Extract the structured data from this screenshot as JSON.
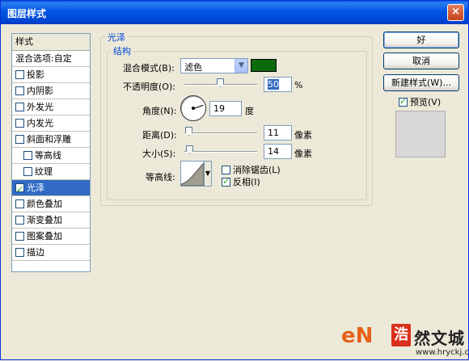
{
  "window": {
    "title": "图层样式",
    "close_glyph": "×"
  },
  "style_list": {
    "header": "样式",
    "items": [
      {
        "label": "混合选项:自定",
        "checkbox": false,
        "checked": false,
        "indent": false,
        "selected": false
      },
      {
        "label": "投影",
        "checkbox": true,
        "checked": false,
        "indent": false,
        "selected": false
      },
      {
        "label": "内阴影",
        "checkbox": true,
        "checked": false,
        "indent": false,
        "selected": false
      },
      {
        "label": "外发光",
        "checkbox": true,
        "checked": false,
        "indent": false,
        "selected": false
      },
      {
        "label": "内发光",
        "checkbox": true,
        "checked": false,
        "indent": false,
        "selected": false
      },
      {
        "label": "斜面和浮雕",
        "checkbox": true,
        "checked": false,
        "indent": false,
        "selected": false
      },
      {
        "label": "等高线",
        "checkbox": true,
        "checked": false,
        "indent": true,
        "selected": false
      },
      {
        "label": "纹理",
        "checkbox": true,
        "checked": false,
        "indent": true,
        "selected": false
      },
      {
        "label": "光泽",
        "checkbox": true,
        "checked": true,
        "indent": false,
        "selected": true
      },
      {
        "label": "颜色叠加",
        "checkbox": true,
        "checked": false,
        "indent": false,
        "selected": false
      },
      {
        "label": "渐变叠加",
        "checkbox": true,
        "checked": false,
        "indent": false,
        "selected": false
      },
      {
        "label": "图案叠加",
        "checkbox": true,
        "checked": false,
        "indent": false,
        "selected": false
      },
      {
        "label": "描边",
        "checkbox": true,
        "checked": false,
        "indent": false,
        "selected": false
      }
    ]
  },
  "satin": {
    "group_title": "光泽",
    "structure_title": "结构",
    "blend_mode_label": "混合模式(B):",
    "blend_mode_value": "滤色",
    "color": "#0b6a0b",
    "opacity_label": "不透明度(O):",
    "opacity_value": "50",
    "opacity_unit": "%",
    "opacity_fraction": 0.5,
    "angle_label": "角度(N):",
    "angle_value": "19",
    "angle_unit": "度",
    "distance_label": "距离(D):",
    "distance_value": "11",
    "distance_unit": "像素",
    "size_label": "大小(S):",
    "size_value": "14",
    "size_unit": "像素",
    "contour_label": "等高线:",
    "antialias_label": "消除锯齿(L)",
    "antialias_checked": false,
    "invert_label": "反相(I)",
    "invert_checked": true
  },
  "buttons": {
    "ok": "好",
    "cancel": "取消",
    "new_style": "新建样式(W)...",
    "preview_label": "预览(V)",
    "preview_checked": true
  },
  "watermark": {
    "brand_prefix": "eN",
    "logo_char": "浩",
    "name": "然文城",
    "url": "www.hryckj.cn"
  }
}
